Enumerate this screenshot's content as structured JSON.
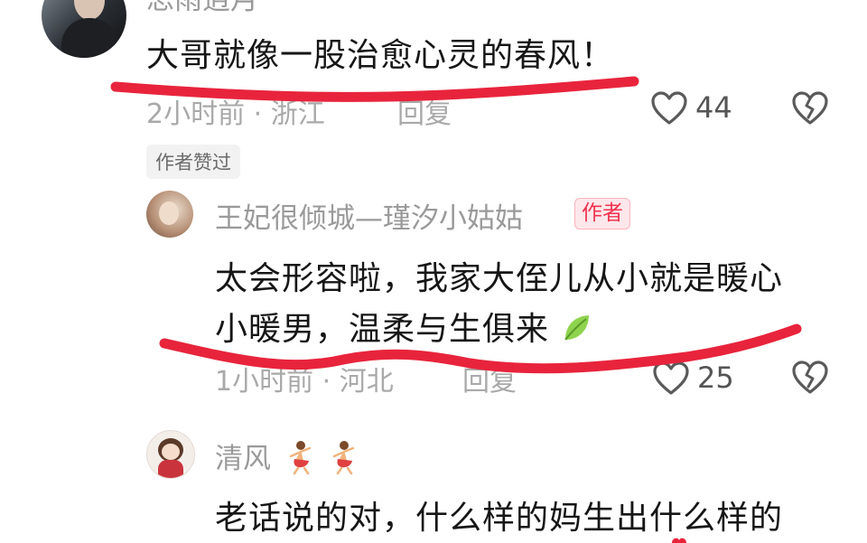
{
  "comments": [
    {
      "user": "思雨逍月",
      "text": "大哥就像一股治愈心灵的春风！",
      "time": "2小时前",
      "location": "浙江",
      "reply": "回复",
      "likes": "44",
      "chip": "作者赞过"
    },
    {
      "user": "王妃很倾城—瑾汐小姑姑",
      "badge": "作者",
      "text_line1": "太会形容啦，我家大侄儿从小就是暖心",
      "text_line2": "小暖男，温柔与生俱来",
      "time": "1小时前",
      "location": "河北",
      "reply": "回复",
      "likes": "25"
    },
    {
      "user": "清风",
      "text": "老话说的对，什么样的妈生出什么样的"
    }
  ],
  "colors": {
    "annotation": "#e8243c",
    "badge_text": "#f0324f",
    "meta": "#a9a9a9"
  },
  "icons": [
    "heart-outline-icon",
    "broken-heart-icon",
    "leaf-emoji-icon",
    "dancer-emoji-icon"
  ]
}
